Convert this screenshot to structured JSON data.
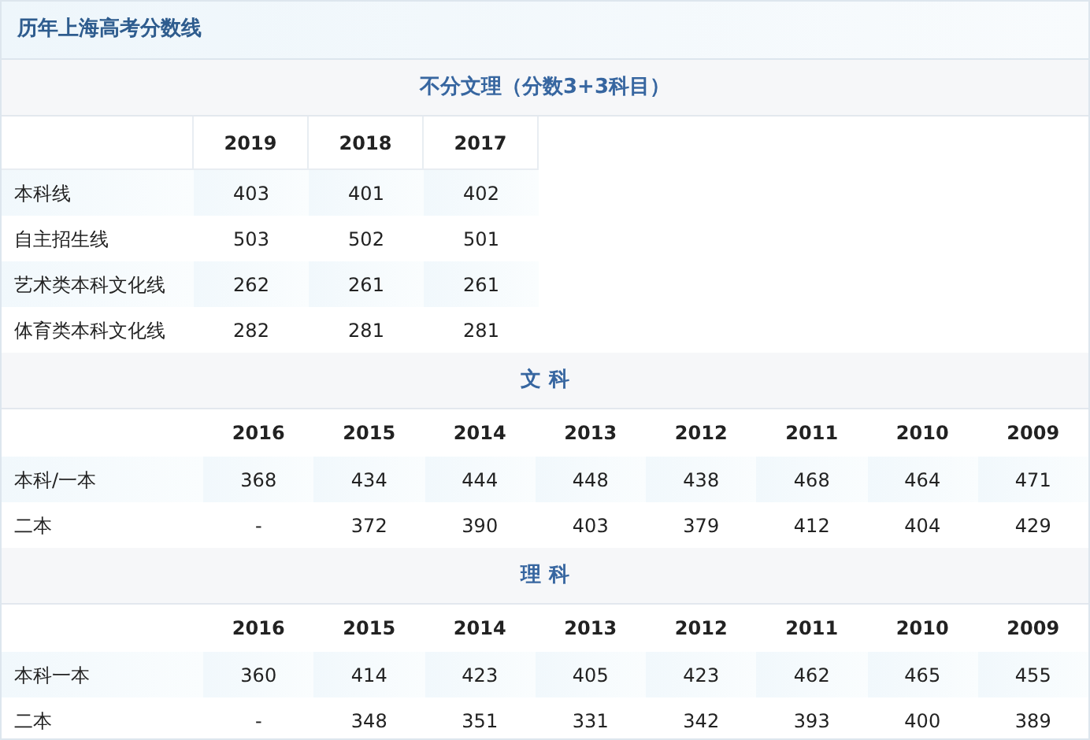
{
  "title": "历年上海高考分数线",
  "sections": [
    {
      "heading": "不分文理（分数3+3科目）",
      "columns": [
        "2019",
        "2018",
        "2017"
      ],
      "rows": [
        {
          "label": "本科线",
          "values": [
            "403",
            "401",
            "402"
          ]
        },
        {
          "label": "自主招生线",
          "values": [
            "503",
            "502",
            "501"
          ]
        },
        {
          "label": "艺术类本科文化线",
          "values": [
            "262",
            "261",
            "261"
          ]
        },
        {
          "label": "体育类本科文化线",
          "values": [
            "282",
            "281",
            "281"
          ]
        }
      ]
    },
    {
      "heading": "文 科",
      "columns": [
        "2016",
        "2015",
        "2014",
        "2013",
        "2012",
        "2011",
        "2010",
        "2009"
      ],
      "rows": [
        {
          "label": "本科/一本",
          "values": [
            "368",
            "434",
            "444",
            "448",
            "438",
            "468",
            "464",
            "471"
          ]
        },
        {
          "label": "二本",
          "values": [
            "-",
            "372",
            "390",
            "403",
            "379",
            "412",
            "404",
            "429"
          ]
        }
      ]
    },
    {
      "heading": "理 科",
      "columns": [
        "2016",
        "2015",
        "2014",
        "2013",
        "2012",
        "2011",
        "2010",
        "2009"
      ],
      "rows": [
        {
          "label": "本科一本",
          "values": [
            "360",
            "414",
            "423",
            "405",
            "423",
            "462",
            "465",
            "455"
          ]
        },
        {
          "label": "二本",
          "values": [
            "-",
            "348",
            "351",
            "331",
            "342",
            "393",
            "400",
            "389"
          ]
        }
      ]
    }
  ]
}
